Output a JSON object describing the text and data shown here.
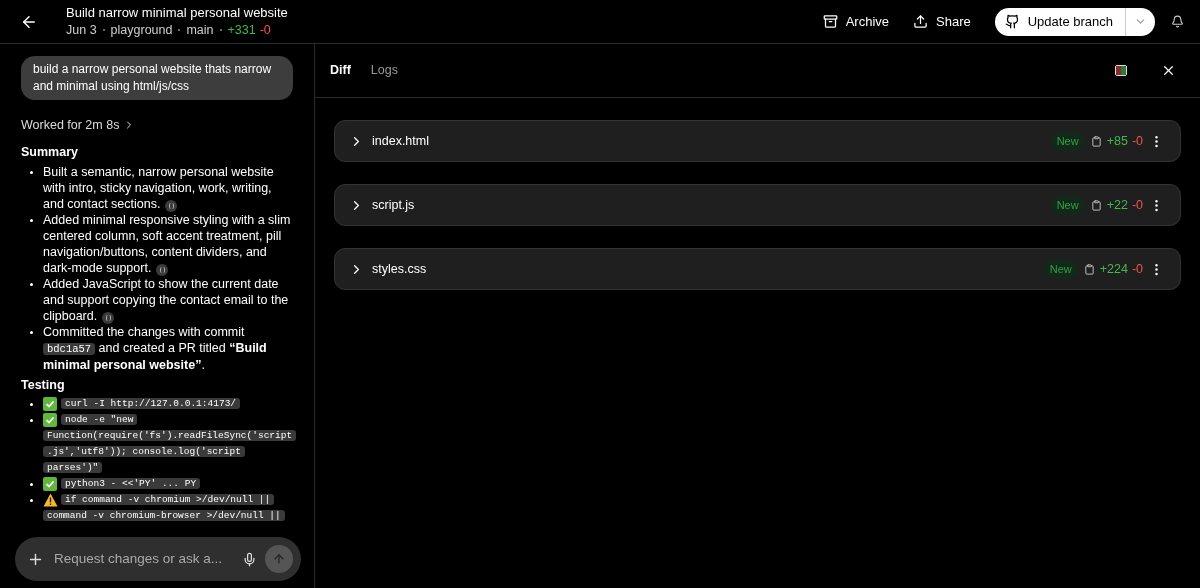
{
  "header": {
    "title": "Build narrow minimal personal website",
    "date": "Jun 3",
    "repo": "playground",
    "branch": "main",
    "additions": "+331",
    "deletions": "-0",
    "actions": [
      {
        "label": "Archive",
        "kind": "archive"
      },
      {
        "label": "Share",
        "kind": "share"
      }
    ],
    "primary": {
      "label": "Update branch"
    }
  },
  "chat": {
    "prompt": "build a narrow personal website thats narrow and minimal using html/js/css",
    "worked": "Worked for 2m 8s",
    "summary_title": "Summary",
    "summary": [
      {
        "parts": [
          {
            "kind": "text",
            "text": "Built a semantic, narrow personal website with intro, sticky navigation, work, writing, and contact sections."
          }
        ],
        "citation": true
      },
      {
        "parts": [
          {
            "kind": "text",
            "text": "Added minimal responsive styling with a slim centered column, soft accent treatment, pill navigation/buttons, content dividers, and dark-mode support."
          }
        ],
        "citation": true
      },
      {
        "parts": [
          {
            "kind": "text",
            "text": "Added JavaScript to show the current date and support copying the contact email to the clipboard."
          }
        ],
        "citation": true
      },
      {
        "parts": [
          {
            "kind": "text",
            "text": "Committed the changes with commit"
          },
          {
            "kind": "code",
            "text": "bdc1a57"
          },
          {
            "kind": "text",
            "text": "and created a PR titled **“Build minimal personal website”**."
          }
        ],
        "citation": false
      }
    ],
    "testing_title": "Testing",
    "testing": [
      {
        "kind": "pass",
        "code": "curl -I http://127.0.0.1:4173/"
      },
      {
        "kind": "pass",
        "code": "node -e \"new Function(require('fs').readFileSync('script.js','utf8')); console.log('script parses')\""
      },
      {
        "kind": "pass",
        "code": "python3 - <<'PY' ... PY"
      },
      {
        "kind": "warn",
        "code": "if command -v chromium >/dev/null || command -v chromium-browser >/dev/null ||"
      }
    ],
    "composer": {
      "placeholder": "Request changes or ask a..."
    }
  },
  "diff_panel": {
    "tabs": [
      {
        "label": "Diff",
        "selected": true
      },
      {
        "label": "Logs",
        "selected": false
      }
    ],
    "files": [
      {
        "name": "index.html",
        "badge": "New",
        "additions": "+85",
        "deletions": "-0"
      },
      {
        "name": "script.js",
        "badge": "New",
        "additions": "+22",
        "deletions": "-0"
      },
      {
        "name": "styles.css",
        "badge": "New",
        "additions": "+224",
        "deletions": "-0"
      }
    ]
  }
}
